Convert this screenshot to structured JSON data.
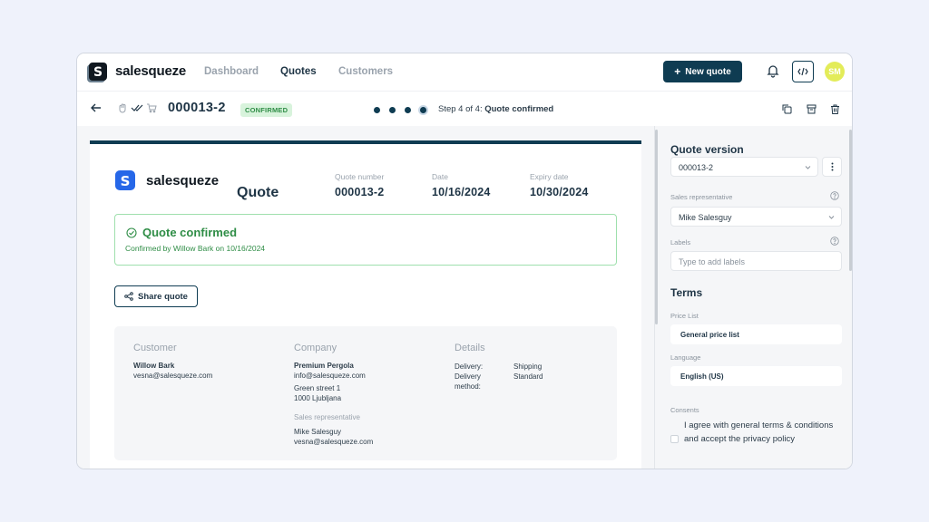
{
  "app": {
    "name": "salesqueze"
  },
  "nav": {
    "items": [
      {
        "label": "Dashboard",
        "active": false
      },
      {
        "label": "Quotes",
        "active": true
      },
      {
        "label": "Customers",
        "active": false
      }
    ],
    "new_quote_label": "New quote",
    "avatar_initials": "SM"
  },
  "subbar": {
    "quote_id": "000013-2",
    "status_badge": "CONFIRMED",
    "step_prefix": "Step 4 of 4:",
    "step_name": "Quote confirmed",
    "steps_total": 4,
    "steps_current": 4
  },
  "document": {
    "brand": "salesqueze",
    "title": "Quote",
    "meta": [
      {
        "label": "Quote number",
        "value": "000013-2"
      },
      {
        "label": "Date",
        "value": "10/16/2024"
      },
      {
        "label": "Expiry date",
        "value": "10/30/2024"
      }
    ],
    "confirmation": {
      "title": "Quote confirmed",
      "subtitle": "Confirmed by Willow Bark on 10/16/2024"
    },
    "share_label": "Share quote",
    "customer": {
      "heading": "Customer",
      "name": "Willow Bark",
      "email": "vesna@salesqueze.com"
    },
    "company": {
      "heading": "Company",
      "name": "Premium Pergola",
      "email": "info@salesqueze.com",
      "street": "Green street 1",
      "city": "1000 Ljubljana",
      "rep_label": "Sales representative",
      "rep_name": "Mike Salesguy",
      "rep_email": "vesna@salesqueze.com"
    },
    "details": {
      "heading": "Details",
      "delivery_label_1": "Delivery:",
      "delivery_value_1": "Shipping",
      "delivery_label_2": "Delivery",
      "delivery_value_2": "Standard",
      "delivery_label_3": "method:"
    }
  },
  "sidebar": {
    "quote_version_heading": "Quote version",
    "quote_version_value": "000013-2",
    "sales_rep_label": "Sales representative",
    "sales_rep_value": "Mike Salesguy",
    "labels_label": "Labels",
    "labels_placeholder": "Type to add labels",
    "terms_heading": "Terms",
    "price_list_label": "Price List",
    "price_list_value": "General price list",
    "language_label": "Language",
    "language_value": "English (US)",
    "consents_label": "Consents",
    "consent_text": "I agree with general terms & conditions and accept the privacy policy"
  },
  "colors": {
    "primary": "#0f3c52",
    "success": "#2f8d46",
    "avatar": "#e3ec59"
  }
}
